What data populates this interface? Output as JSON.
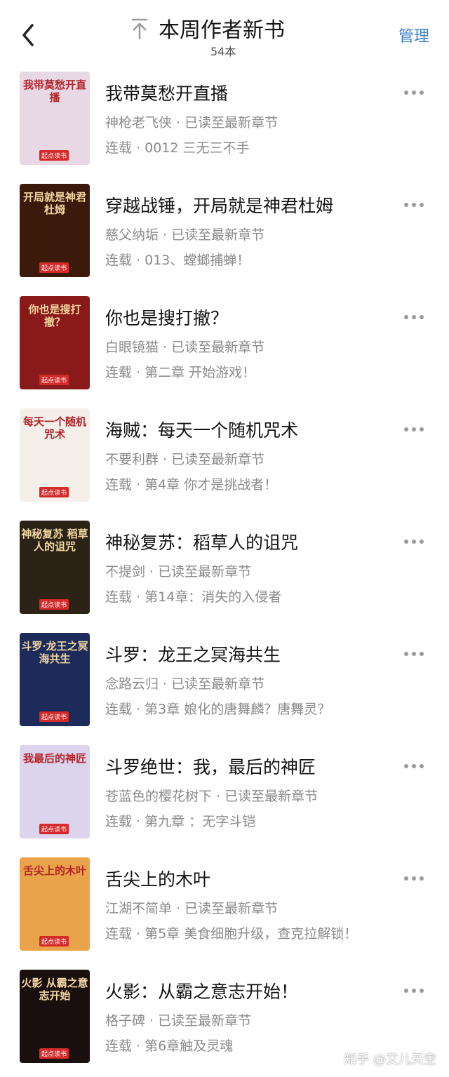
{
  "header": {
    "title": "本周作者新书",
    "count": "54本",
    "manage_label": "管理",
    "back_icon": "chevron-left-icon",
    "top_icon": "arrow-up-to-top-icon"
  },
  "books": [
    {
      "cover_text": "我带莫愁开直播",
      "title": "我带莫愁开直播",
      "meta": "神枪老飞侠 · 已读至最新章节",
      "progress": "连载 · 0012 三无三不手",
      "cover_color": "#e8d8e4"
    },
    {
      "cover_text": "开局就是神君杜姆",
      "title": "穿越战锤，开局就是神君杜姆",
      "meta": "慈父纳垢 · 已读至最新章节",
      "progress": "连载 · 013、螳螂捕蝉！",
      "cover_color": "#3b1a0c"
    },
    {
      "cover_text": "你也是搜打撤？",
      "title": "你也是搜打撤？",
      "meta": "白眼镜猫 · 已读至最新章节",
      "progress": "连载 · 第二章 开始游戏！",
      "cover_color": "#8a1a1a"
    },
    {
      "cover_text": "每天一个随机咒术",
      "title": "海贼：每天一个随机咒术",
      "meta": "不要利群 · 已读至最新章节",
      "progress": "连载 · 第4章 你才是挑战者！",
      "cover_color": "#f4efe8"
    },
    {
      "cover_text": "神秘复苏 稻草人的诅咒",
      "title": "神秘复苏：稻草人的诅咒",
      "meta": "不提剑 · 已读至最新章节",
      "progress": "连载 · 第14章：消失的入侵者",
      "cover_color": "#2b2416"
    },
    {
      "cover_text": "斗罗·龙王之冥海共生",
      "title": "斗罗：龙王之冥海共生",
      "meta": "念路云归 · 已读至最新章节",
      "progress": "连载 · 第3章 娘化的唐舞麟？唐舞灵？",
      "cover_color": "#1c2b5a"
    },
    {
      "cover_text": "我最后的神匠",
      "title": "斗罗绝世：我，最后的神匠",
      "meta": "苍蓝色的樱花树下 · 已读至最新章节",
      "progress": "连载 · 第九章 ：无字斗铠",
      "cover_color": "#dcd4ec"
    },
    {
      "cover_text": "舌尖上的木叶",
      "title": "舌尖上的木叶",
      "meta": "江湖不简单 · 已读至最新章节",
      "progress": "连载 · 第5章 美食细胞升级，查克拉解锁！",
      "cover_color": "#e9a34a"
    },
    {
      "cover_text": "火影 从霸之意志开始",
      "title": "火影：从霸之意志开始！",
      "meta": "格子碑 · 已读至最新章节",
      "progress": "连载 · 第6章触及灵魂",
      "cover_color": "#1a0f0f"
    }
  ],
  "cover_badge": "起点读书",
  "watermark": "知乎 @艾儿天空"
}
